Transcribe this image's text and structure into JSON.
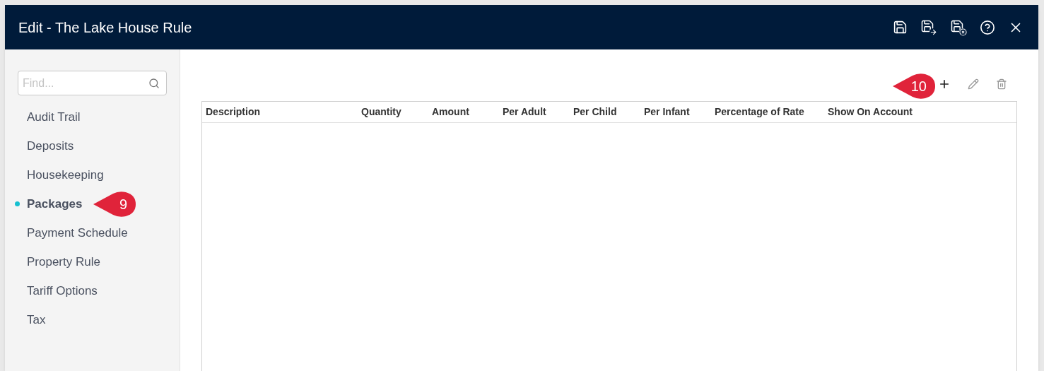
{
  "window": {
    "title": "Edit - The Lake House Rule"
  },
  "search": {
    "placeholder": "Find..."
  },
  "sidebar": {
    "items": [
      {
        "label": "Audit Trail",
        "selected": false
      },
      {
        "label": "Deposits",
        "selected": false
      },
      {
        "label": "Housekeeping",
        "selected": false
      },
      {
        "label": "Packages",
        "selected": true
      },
      {
        "label": "Payment Schedule",
        "selected": false
      },
      {
        "label": "Property Rule",
        "selected": false
      },
      {
        "label": "Tariff Options",
        "selected": false
      },
      {
        "label": "Tax",
        "selected": false
      }
    ]
  },
  "table": {
    "columns": [
      "Description",
      "Quantity",
      "Amount",
      "Per Adult",
      "Per Child",
      "Per Infant",
      "Percentage of Rate",
      "Show On Account"
    ]
  },
  "sidebar_callout": {
    "number": "9"
  },
  "toolbar_callout": {
    "number": "10"
  }
}
